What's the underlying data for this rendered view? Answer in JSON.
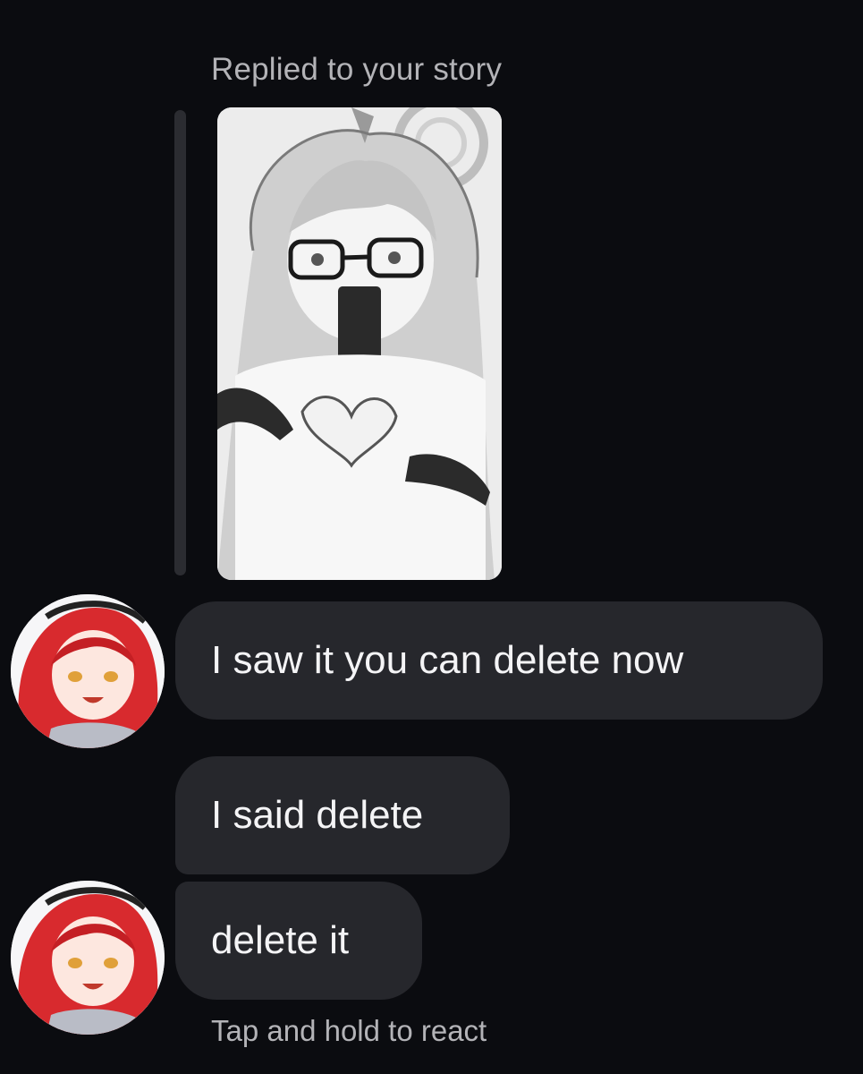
{
  "story_reply": {
    "label": "Replied to your story"
  },
  "messages": [
    {
      "text": "I saw it you can delete now"
    },
    {
      "text": "I said delete"
    },
    {
      "text": "delete it"
    }
  ],
  "footer": {
    "hint": "Tap and hold to react"
  },
  "colors": {
    "background": "#0b0c10",
    "bubble": "#26272c",
    "secondary_text": "#b3b3b7",
    "avatar_hair": "#d82a2e"
  }
}
